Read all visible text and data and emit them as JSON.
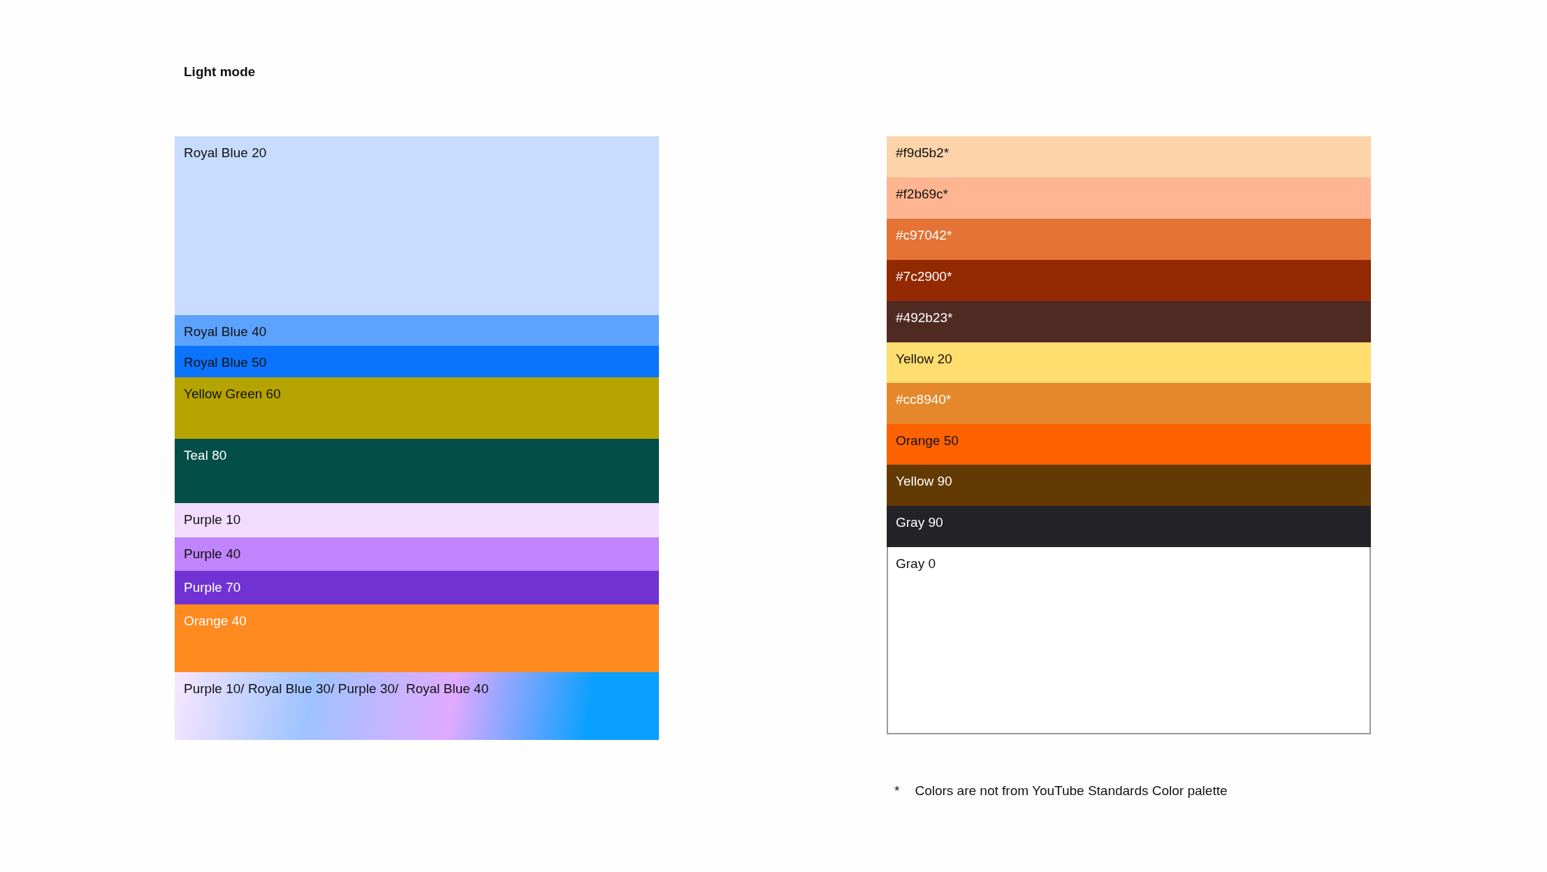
{
  "title": "Light mode",
  "left_swatches": [
    {
      "label": "Royal Blue 20",
      "color": "#c8dcff",
      "light_text": false
    },
    {
      "label": "Royal Blue 40",
      "color": "#5ca2ff",
      "light_text": false
    },
    {
      "label": "Royal Blue 50",
      "color": "#0a74ff",
      "light_text": false
    },
    {
      "label": "Yellow Green 60",
      "color": "#b5a300",
      "light_text": false
    },
    {
      "label": "Teal 80",
      "color": "#034e47",
      "light_text": true
    },
    {
      "label": "Purple 10",
      "color": "#f2dcff",
      "light_text": false
    },
    {
      "label": "Purple 40",
      "color": "#c084fc",
      "light_text": false
    },
    {
      "label": "Purple 70",
      "color": "#7132d4",
      "light_text": true
    },
    {
      "label": "Orange 40",
      "color": "#ff8a1f",
      "light_text": true
    },
    {
      "label": "Purple 10/ Royal Blue 30/ Purple 30/  Royal Blue 40",
      "kind": "gradient",
      "stops": [
        {
          "color": "#f7e6ff"
        },
        {
          "color": "#9ec3ff"
        },
        {
          "color": "#e0aaff"
        },
        {
          "color": "#0aa0ff"
        }
      ],
      "light_text": false
    }
  ],
  "right_swatches": [
    {
      "label": "#f9d5b2*",
      "color": "#fdd3a9",
      "light_text": false
    },
    {
      "label": "#f2b69c*",
      "color": "#ffb591",
      "light_text": false
    },
    {
      "label": "#c97042*",
      "color": "#e47335",
      "light_text": true
    },
    {
      "label": "#7c2900*",
      "color": "#922900",
      "light_text": true
    },
    {
      "label": "#492b23*",
      "color": "#4f2a22",
      "light_text": true
    },
    {
      "label": "Yellow 20",
      "color": "#ffdd6e",
      "light_text": false
    },
    {
      "label": "#cc8940*",
      "color": "#e5882b",
      "light_text": true
    },
    {
      "label": "Orange 50",
      "color": "#ff6200",
      "light_text": false
    },
    {
      "label": "Yellow 90",
      "color": "#633a03",
      "light_text": true
    },
    {
      "label": "Gray 90",
      "color": "#242428",
      "light_text": true
    },
    {
      "label": "Gray 0",
      "color": "#ffffff",
      "light_text": false,
      "bordered": true
    }
  ],
  "footnote": {
    "mark": "*",
    "text": "Colors are not from YouTube Standards Color palette"
  }
}
